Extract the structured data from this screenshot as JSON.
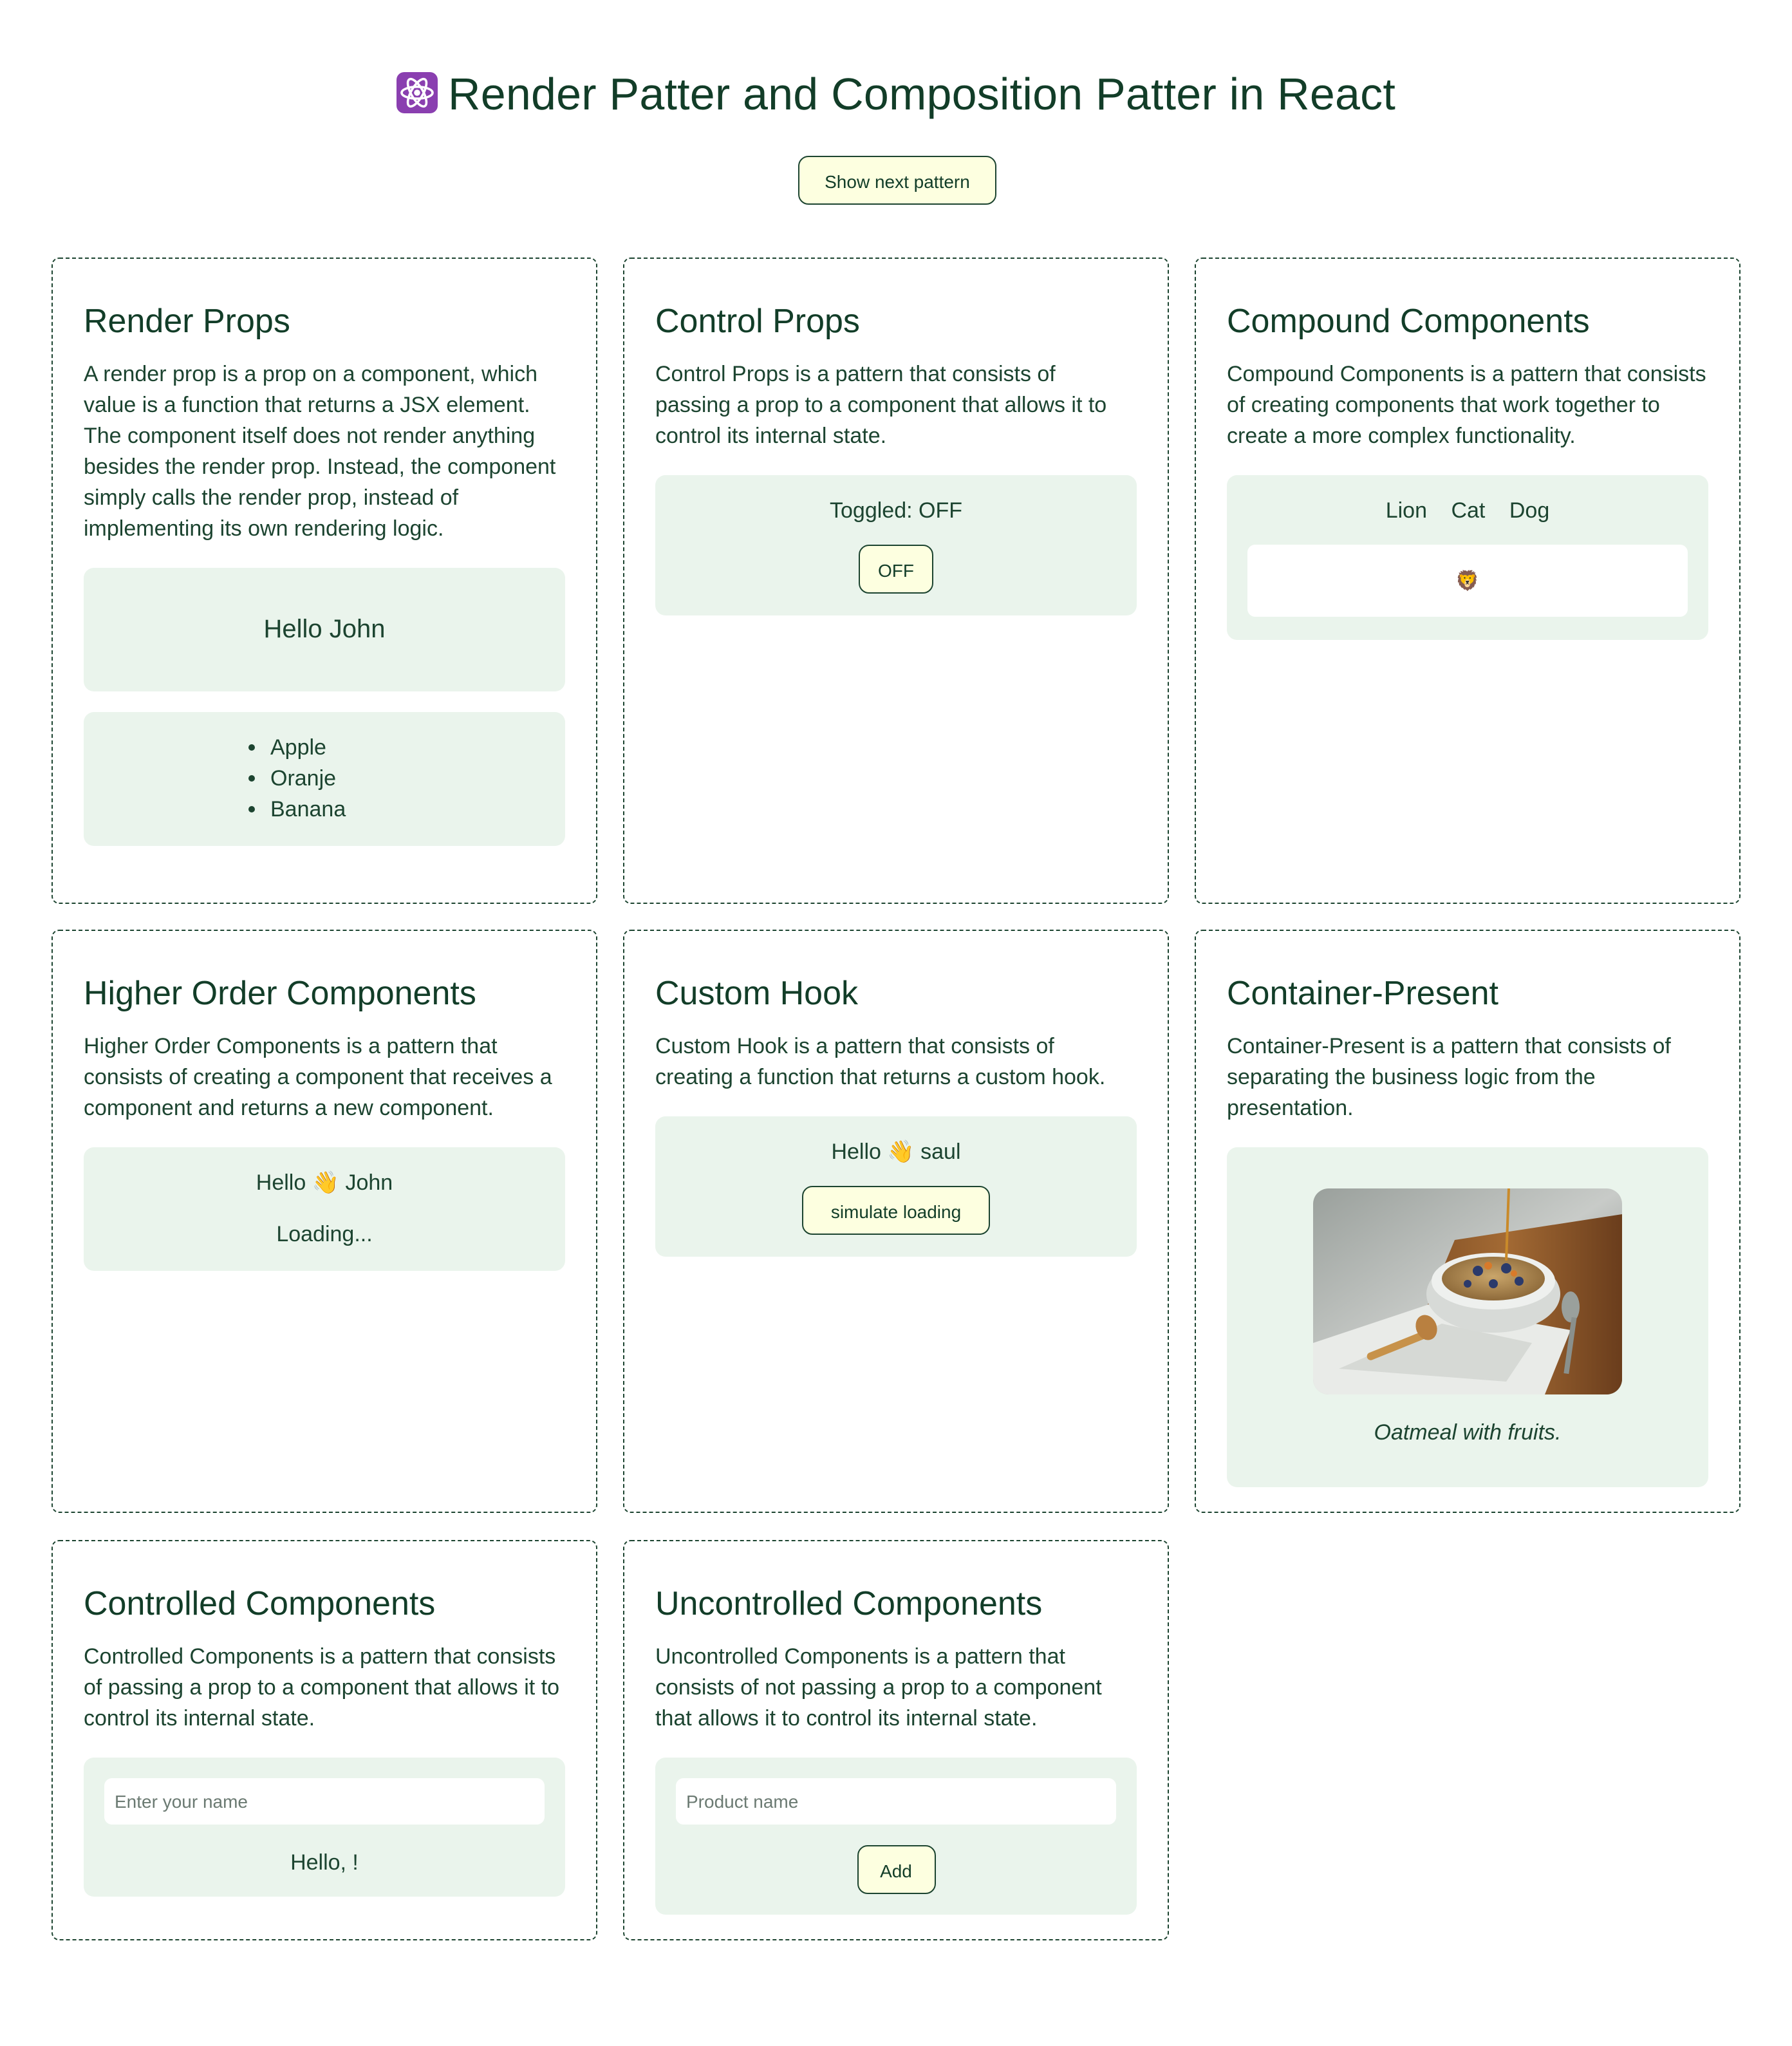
{
  "header": {
    "icon": "atom-icon",
    "title": "Render Patter and Composition Patter in React",
    "next_button": "Show next pattern"
  },
  "colors": {
    "text": "#123d28",
    "demo_background": "#eaf4ec",
    "button_background": "#fdffe0",
    "border": "#1c4430"
  },
  "cards": {
    "render_props": {
      "title": "Render Props",
      "description": "A render prop is a prop on a component, which value is a function that returns a JSX element. The component itself does not render anything besides the render prop. Instead, the component simply calls the render prop, instead of implementing its own rendering logic.",
      "greeting": "Hello John",
      "fruits": [
        "Apple",
        "Oranje",
        "Banana"
      ]
    },
    "control_props": {
      "title": "Control Props",
      "description": "Control Props is a pattern that consists of passing a prop to a component that allows it to control its internal state.",
      "status": "Toggled: OFF",
      "button": "OFF"
    },
    "compound_components": {
      "title": "Compound Components",
      "description": "Compound Components is a pattern that consists of creating components that work together to create a more complex functionality.",
      "tabs": [
        "Lion",
        "Cat",
        "Dog"
      ],
      "panel": "🦁"
    },
    "higher_order": {
      "title": "Higher Order Components",
      "description": "Higher Order Components is a pattern that consists of creating a component that receives a component and returns a new component.",
      "greeting": "Hello 👋 John",
      "loading": "Loading..."
    },
    "custom_hook": {
      "title": "Custom Hook",
      "description": "Custom Hook is a pattern that consists of creating a function that returns a custom hook.",
      "greeting": "Hello 👋 saul",
      "button": "simulate loading"
    },
    "container_present": {
      "title": "Container-Present",
      "description": "Container-Present is a pattern that consists of separating the business logic from the presentation.",
      "caption": "Oatmeal with fruits."
    },
    "controlled": {
      "title": "Controlled Components",
      "description": "Controlled Components is a pattern that consists of passing a prop to a component that allows it to control its internal state.",
      "input_placeholder": "Enter your name",
      "input_value": "",
      "greeting": "Hello, !"
    },
    "uncontrolled": {
      "title": "Uncontrolled Components",
      "description": "Uncontrolled Components is a pattern that consists of not passing a prop to a component that allows it to control its internal state.",
      "input_placeholder": "Product name",
      "input_value": "",
      "button": "Add"
    }
  }
}
